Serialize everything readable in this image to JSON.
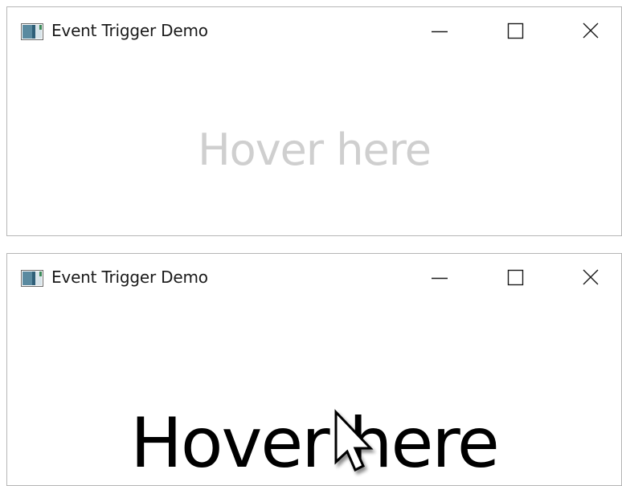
{
  "windows": [
    {
      "title": "Event Trigger Demo",
      "hover_text": "Hover here",
      "state": "idle",
      "text_color": "#cfcfcf"
    },
    {
      "title": "Event Trigger Demo",
      "hover_text": "Hover here",
      "state": "hovered",
      "text_color": "#000000"
    }
  ],
  "icons": {
    "app": "app-window-icon",
    "minimize": "minimize-icon",
    "maximize": "maximize-icon",
    "close": "close-icon",
    "cursor": "mouse-pointer-icon"
  }
}
